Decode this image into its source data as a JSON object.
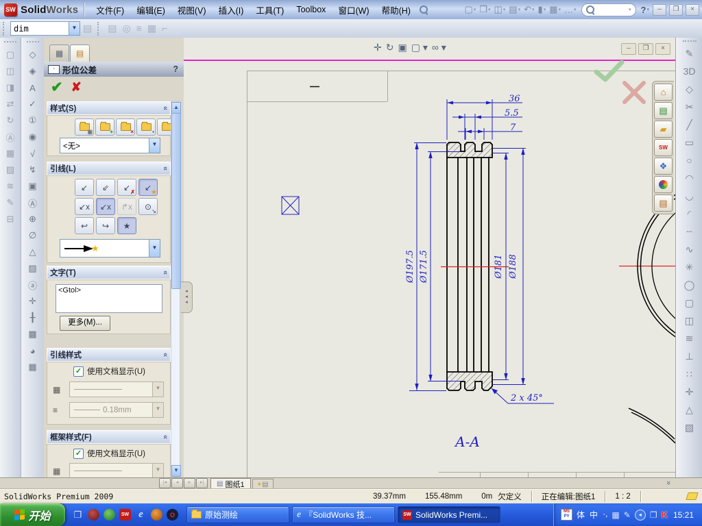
{
  "window": {
    "brand_solid": "Solid",
    "brand_works": "Works",
    "menus": [
      {
        "n": "menu-file",
        "label": "文件(F)"
      },
      {
        "n": "menu-edit",
        "label": "编辑(E)"
      },
      {
        "n": "menu-view",
        "label": "视图(V)"
      },
      {
        "n": "menu-insert",
        "label": "插入(I)"
      },
      {
        "n": "menu-tools",
        "label": "工具(T)"
      },
      {
        "n": "menu-toolbox",
        "label": "Toolbox"
      },
      {
        "n": "menu-window",
        "label": "窗口(W)"
      },
      {
        "n": "menu-help",
        "label": "帮助(H)"
      }
    ],
    "quick_icons": [
      {
        "n": "new-document-icon",
        "g": "▢"
      },
      {
        "n": "open-icon",
        "g": "❒"
      },
      {
        "n": "save-icon",
        "g": "◫"
      },
      {
        "n": "print-icon",
        "g": "▤"
      },
      {
        "n": "undo-icon",
        "g": "↶"
      },
      {
        "n": "select-icon",
        "g": "▮"
      },
      {
        "n": "options-icon",
        "g": "▦"
      },
      {
        "n": "overflow-ellipsis",
        "g": "…"
      }
    ],
    "help_glyph": "?",
    "controls": {
      "minimize": "–",
      "restore": "❐",
      "close": "×"
    }
  },
  "toolbar2": {
    "combo_value": "dim",
    "icons": [
      {
        "n": "layer-icon",
        "g": "▤"
      },
      {
        "n": "layer-properties-icon",
        "g": "◎"
      },
      {
        "n": "line-format-icon",
        "g": "≡"
      },
      {
        "n": "line-style-icon",
        "g": "▦"
      },
      {
        "n": "corner-icon",
        "g": "⌐"
      }
    ]
  },
  "left_toolbar_outer": {
    "icons": [
      {
        "n": "sheet-icon",
        "g": "▢"
      },
      {
        "n": "model-view-icon",
        "g": "◫"
      },
      {
        "n": "projected-view-icon",
        "g": "◨"
      },
      {
        "n": "swap-view-icon",
        "g": "⇄"
      },
      {
        "n": "update-view-icon",
        "g": "↻"
      },
      {
        "n": "annotation-font-icon",
        "g": "Ⓐ"
      },
      {
        "n": "multi-view-icon",
        "g": "▦"
      },
      {
        "n": "image-icon",
        "g": "▨"
      },
      {
        "n": "section-line-icon",
        "g": "≋"
      },
      {
        "n": "edit-sketch-icon",
        "g": "✎"
      },
      {
        "n": "layout-icon",
        "g": "⊟"
      }
    ]
  },
  "left_toolbar_annotation": {
    "icons": [
      {
        "n": "note-tag-icon",
        "g": "◇"
      },
      {
        "n": "note-edit-icon",
        "g": "◈"
      },
      {
        "n": "note-icon",
        "g": "A"
      },
      {
        "n": "spell-check-icon",
        "g": "✓"
      },
      {
        "n": "balloon-icon",
        "g": "①"
      },
      {
        "n": "auto-balloon-icon",
        "g": "◉"
      },
      {
        "n": "surface-finish-icon",
        "g": "√"
      },
      {
        "n": "weld-symbol-icon",
        "g": "↯"
      },
      {
        "n": "geometric-tolerance-icon",
        "g": "▣"
      },
      {
        "n": "datum-feature-icon",
        "g": "Ⓐ"
      },
      {
        "n": "datum-target-icon",
        "g": "⊕"
      },
      {
        "n": "hole-callout-icon",
        "g": "∅"
      },
      {
        "n": "revision-symbol-icon",
        "g": "△"
      },
      {
        "n": "area-hatch-icon",
        "g": "▨"
      },
      {
        "n": "annotation-note-icon",
        "g": "ⓐ"
      },
      {
        "n": "center-mark-icon",
        "g": "✛"
      },
      {
        "n": "centerline-icon",
        "g": "╂"
      },
      {
        "n": "blocks-icon",
        "g": "▩"
      },
      {
        "n": "appearance-sphere-icon",
        "g": "◕"
      },
      {
        "n": "table-icon",
        "g": "▦"
      }
    ]
  },
  "property_manager": {
    "title": "形位公差",
    "help": "?",
    "tabs": [
      {
        "n": "propertymanager-tab",
        "g": "▦"
      },
      {
        "n": "custom-properties-tab",
        "g": "▤"
      }
    ],
    "ok_icon": "✔",
    "cancel_icon": "✘",
    "style": {
      "header": "样式(S)",
      "buttons": [
        {
          "n": "style-defaults-button",
          "m": "▣",
          "c": "mk-gray"
        },
        {
          "n": "style-add-button",
          "m": "+",
          "c": "mk-green"
        },
        {
          "n": "style-delete-button",
          "m": "×",
          "c": "mk-red"
        },
        {
          "n": "style-save-button",
          "m": "▪",
          "c": "mk-blue"
        },
        {
          "n": "style-load-button",
          "m": "▫",
          "c": "mk-blue"
        }
      ],
      "dropdown_value": "<无>"
    },
    "leader": {
      "header": "引线(L)",
      "row1": [
        {
          "n": "leader-button",
          "g": "↙",
          "m": "",
          "c": "",
          "mc": ""
        },
        {
          "n": "multi-jog-leader-button",
          "g": "⇙",
          "m": "",
          "c": "",
          "mc": ""
        },
        {
          "n": "no-leader-button",
          "g": "↙",
          "m": "✗",
          "c": "",
          "mc": "mk-red"
        },
        {
          "n": "auto-leader-button",
          "g": "↙",
          "m": "★",
          "c": "sel",
          "mc": "mk-gold"
        }
      ],
      "row2": [
        {
          "n": "leader-left-button",
          "g": "↙x",
          "m": "",
          "c": "",
          "mc": ""
        },
        {
          "n": "leader-right-button",
          "g": "↙x",
          "m": "",
          "c": "sel",
          "mc": ""
        },
        {
          "n": "bent-leader-button",
          "g": "↱x",
          "m": "",
          "c": "disabled",
          "mc": ""
        },
        {
          "n": "leader-to-nearest-button",
          "g": "⊙",
          "m": "↘",
          "c": "",
          "mc": "mk-gray"
        }
      ],
      "row3": [
        {
          "n": "bent-leader-left-button",
          "g": "↩",
          "m": "",
          "c": "",
          "mc": ""
        },
        {
          "n": "bent-leader-right-button",
          "g": "↪",
          "m": "",
          "c": "",
          "mc": ""
        },
        {
          "n": "auto-bent-leader-button",
          "g": "★",
          "m": "",
          "c": "sel",
          "mc": ""
        }
      ]
    },
    "text": {
      "header": "文字(T)",
      "value": "<Gtol>",
      "more_button": "更多(M)..."
    },
    "leader_style": {
      "header": "引线样式",
      "use_doc_label": "使用文档显示(U)",
      "thickness_value": "0.18mm"
    },
    "frame_style": {
      "header": "框架样式(F)",
      "use_doc_label": "使用文档显示(U)"
    }
  },
  "heads_up": {
    "icons": [
      {
        "n": "zoom-fit-icon",
        "g": "",
        "c": "ismag"
      },
      {
        "n": "zoom-area-icon",
        "g": "",
        "c": "ismag"
      },
      {
        "n": "pan-icon",
        "g": "✛",
        "c": ""
      },
      {
        "n": "rotate-view-icon",
        "g": "↻",
        "c": ""
      },
      {
        "n": "drawing-view-icon",
        "g": "▣",
        "c": ""
      },
      {
        "n": "display-style-icon",
        "g": "▢ ▾",
        "c": ""
      },
      {
        "n": "view-settings-icon",
        "g": "∞ ▾",
        "c": ""
      }
    ]
  },
  "task_pane": {
    "tabs": [
      {
        "n": "home-tab",
        "g": "⌂",
        "c": "c-home"
      },
      {
        "n": "design-library-tab",
        "g": "▤",
        "c": "c-lib"
      },
      {
        "n": "file-explorer-tab",
        "g": "▰",
        "c": "c-folder"
      },
      {
        "n": "sw-search-tab",
        "g": "SW",
        "c": "c-sw"
      },
      {
        "n": "view-palette-tab",
        "g": "❖",
        "c": "c-pal"
      },
      {
        "n": "appearances-tab",
        "g": "●",
        "c": "c-wheel"
      },
      {
        "n": "custom-props-tab",
        "g": "▤",
        "c": "c-props"
      }
    ]
  },
  "right_toolbar": {
    "icons": [
      {
        "n": "sketch-icon",
        "g": "✎"
      },
      {
        "n": "sketch-3d-icon",
        "g": "3D"
      },
      {
        "n": "smart-dimension-icon",
        "g": "◇"
      },
      {
        "n": "trim-icon",
        "g": "✂"
      },
      {
        "n": "line-icon",
        "g": "╱"
      },
      {
        "n": "rectangle-icon",
        "g": "▭"
      },
      {
        "n": "circle-icon",
        "g": "○"
      },
      {
        "n": "centerpoint-arc-icon",
        "g": "◠"
      },
      {
        "n": "tangent-arc-icon",
        "g": "◡"
      },
      {
        "n": "three-point-arc-icon",
        "g": "◜"
      },
      {
        "n": "centerline-tool-icon",
        "g": "┄"
      },
      {
        "n": "spline-icon",
        "g": "∿"
      },
      {
        "n": "point-icon",
        "g": "✳"
      },
      {
        "n": "polygon-icon",
        "g": "◯"
      },
      {
        "n": "slot-icon",
        "g": "▢"
      },
      {
        "n": "mirror-entities-icon",
        "g": "◫"
      },
      {
        "n": "offset-entities-icon",
        "g": "≋"
      },
      {
        "n": "convert-entities-icon",
        "g": "⊥"
      },
      {
        "n": "sketch-pattern-icon",
        "g": "∷"
      },
      {
        "n": "move-entities-icon",
        "g": "✛"
      },
      {
        "n": "warning-triangle-icon",
        "g": "△"
      },
      {
        "n": "block-icon",
        "g": "▧"
      }
    ]
  },
  "drawing": {
    "dims": {
      "d36": "36",
      "d55": "5.5",
      "d7": "7",
      "d1975": "Ø197.5",
      "d1715": "Ø171.5",
      "d181": "Ø181",
      "d188": "Ø188",
      "chamfer": "2 x 45°",
      "section_label": "A-A"
    },
    "colors": {
      "dimension": "#1F1FBF",
      "centerline": "#E02424",
      "profile": "#000000",
      "highlight": "#E822D0"
    }
  },
  "sheet_tabs": {
    "tab1_label": "图纸1"
  },
  "status_bar": {
    "product": "SolidWorks Premium 2009",
    "pos_x": "39.37mm",
    "pos_y": "155.48mm",
    "pos_z": "0m",
    "state": "欠定义",
    "editing": "正在编辑:图纸1",
    "scale": "1 : 2"
  },
  "taskbar": {
    "start_label": "开始",
    "quick_launch": [
      {
        "n": "show-desktop-icon",
        "g": "❐",
        "c": "ql-desk"
      },
      {
        "n": "realplayer-icon",
        "g": "",
        "c": "ql-real"
      },
      {
        "n": "qq-icon",
        "g": "",
        "c": "ql-qq"
      },
      {
        "n": "solidworks-icon",
        "g": "SW",
        "c": "ql-sw"
      },
      {
        "n": "ie-icon",
        "g": "e",
        "c": "ql-ie"
      },
      {
        "n": "browser-icon",
        "g": "",
        "c": "ql-comp"
      },
      {
        "n": "opera-icon",
        "g": "O",
        "c": "ql-opera"
      }
    ],
    "tasks": [
      {
        "n": "task-folder",
        "label": "原始测绘",
        "ic": "tk-folder",
        "g": "",
        "c": ""
      },
      {
        "n": "task-ie",
        "label": "『SolidWorks 技...",
        "ic": "tk-ie",
        "g": "e",
        "c": ""
      },
      {
        "n": "task-solidworks",
        "label": "SolidWorks Premi...",
        "ic": "tk-sw",
        "g": "SW",
        "c": "active"
      }
    ],
    "tray_texts": [
      {
        "n": "ime-shape-indicator",
        "t": "体"
      },
      {
        "n": "ime-lang-indicator",
        "t": "中"
      },
      {
        "n": "ime-punct-indicator",
        "t": "·,"
      }
    ],
    "mspy_top": "MS",
    "mspy_bottom": "PY",
    "time": "15:21"
  }
}
